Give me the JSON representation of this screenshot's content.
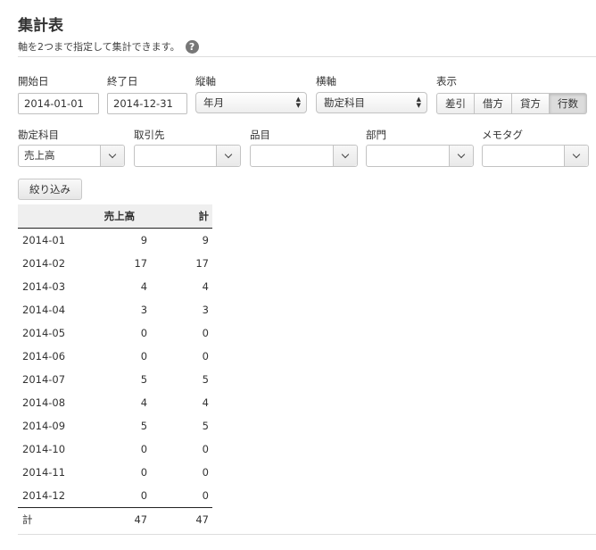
{
  "header": {
    "title": "集計表",
    "subtitle": "軸を2つまで指定して集計できます。",
    "help_icon": "question-circle-icon",
    "help_glyph": "?"
  },
  "filters": {
    "start_label": "開始日",
    "start_value": "2014-01-01",
    "end_label": "終了日",
    "end_value": "2014-12-31",
    "vertical_axis_label": "縦軸",
    "vertical_axis_value": "年月",
    "horizontal_axis_label": "横軸",
    "horizontal_axis_value": "勘定科目",
    "display_label": "表示",
    "display_options": [
      "差引",
      "借方",
      "貸方",
      "行数"
    ],
    "display_selected": "行数",
    "account_label": "勘定科目",
    "account_value": "売上高",
    "partner_label": "取引先",
    "partner_value": "",
    "item_label": "品目",
    "item_value": "",
    "section_label": "部門",
    "section_value": "",
    "memo_tag_label": "メモタグ",
    "memo_tag_value": "",
    "apply_button": "絞り込み"
  },
  "table": {
    "headers": [
      "",
      "売上高",
      "計"
    ],
    "rows": [
      [
        "2014-01",
        "9",
        "9"
      ],
      [
        "2014-02",
        "17",
        "17"
      ],
      [
        "2014-03",
        "4",
        "4"
      ],
      [
        "2014-04",
        "3",
        "3"
      ],
      [
        "2014-05",
        "0",
        "0"
      ],
      [
        "2014-06",
        "0",
        "0"
      ],
      [
        "2014-07",
        "5",
        "5"
      ],
      [
        "2014-08",
        "4",
        "4"
      ],
      [
        "2014-09",
        "5",
        "5"
      ],
      [
        "2014-10",
        "0",
        "0"
      ],
      [
        "2014-11",
        "0",
        "0"
      ],
      [
        "2014-12",
        "0",
        "0"
      ]
    ],
    "total": [
      "計",
      "47",
      "47"
    ]
  }
}
